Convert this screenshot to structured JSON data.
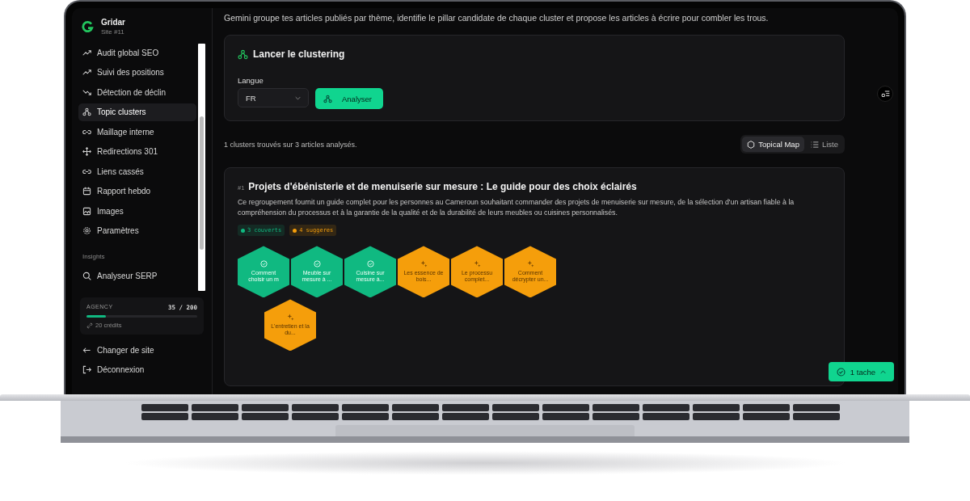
{
  "brand": {
    "name": "Gridar",
    "site": "Site #11"
  },
  "sidebar": {
    "items": [
      {
        "label": "Audit global SEO",
        "selected": false
      },
      {
        "label": "Suivi des positions",
        "selected": false
      },
      {
        "label": "Détection de déclin",
        "selected": false
      },
      {
        "label": "Topic clusters",
        "selected": true
      },
      {
        "label": "Maillage interne",
        "selected": false
      },
      {
        "label": "Redirections 301",
        "selected": false
      },
      {
        "label": "Liens cassés",
        "selected": false
      },
      {
        "label": "Rapport hebdo",
        "selected": false
      },
      {
        "label": "Images",
        "selected": false
      },
      {
        "label": "Paramètres",
        "selected": false
      }
    ],
    "section": "Insights",
    "insights": [
      {
        "label": "Analyseur SERP",
        "selected": false
      }
    ],
    "plan": {
      "name": "AGENCY",
      "usage": "35 / 200",
      "level": 0.175,
      "credits": "20 crédits"
    },
    "footer": [
      "Changer de site",
      "Déconnexion"
    ]
  },
  "description": "Gemini groupe tes articles publiés par thème, identifie le pillar candidate de chaque cluster et propose les articles à écrire pour combler les trous.",
  "launch": {
    "title": "Lancer le clustering",
    "language_label": "Langue",
    "language": "FR",
    "button": "Analyser"
  },
  "summary": "1 clusters trouvés sur 3 articles analysés.",
  "views": [
    {
      "label": "Topical Map",
      "selected": true
    },
    {
      "label": "Liste",
      "selected": false
    }
  ],
  "cluster": {
    "number": "#1",
    "title": "Projets d'ébénisterie et de menuiserie sur mesure : Le guide pour des choix éclairés",
    "summary": "Ce regroupement fournit un guide complet pour les personnes au Cameroun souhaitant commander des projets de menuiserie sur mesure, de la sélection d'un artisan fiable à la compréhension du processus et à la garantie de la qualité et de la durabilité de leurs meubles ou cuisines personnalisés.",
    "badges": [
      {
        "label": "3 couverts",
        "color": "#10b981"
      },
      {
        "label": "4 suggeres",
        "color": "#f59e0b"
      }
    ],
    "nodes": [
      {
        "label": "Comment choisir un m",
        "kind": "covered"
      },
      {
        "label": "Meuble sur mesure à ...",
        "kind": "covered"
      },
      {
        "label": "Cuisine sur mesure à...",
        "kind": "covered"
      },
      {
        "label": "Les essence de bois...",
        "kind": "suggested"
      },
      {
        "label": "Le processu complet...",
        "kind": "suggested"
      },
      {
        "label": "Comment décrypter un...",
        "kind": "suggested"
      },
      {
        "label": "L'entretien et la du...",
        "kind": "suggested"
      }
    ]
  },
  "tasks": "1 tache"
}
